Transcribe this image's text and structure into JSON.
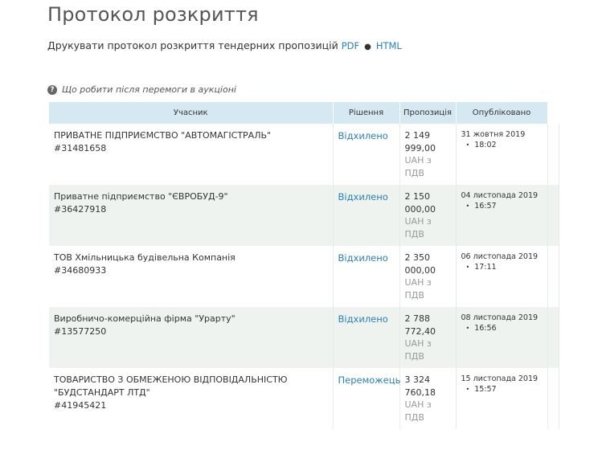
{
  "page": {
    "title": "Протокол розкриття",
    "print_text": "Друкувати протокол розкриття тендерних пропозицій",
    "pdf_link": "PDF",
    "separator": "●",
    "html_link": "HTML",
    "help_text": "Що робити після перемоги в аукціоні"
  },
  "table": {
    "headers": {
      "participant": "Учасник",
      "decision": "Рішення",
      "bid": "Пропозиція",
      "published": "Опубліковано"
    },
    "rows": [
      {
        "name": "ПРИВАТНЕ ПІДПРИЄМСТВО \"АВТОМАГІСТРАЛЬ\"",
        "code": "#31481658",
        "decision": "Відхилено",
        "amount_1": "2 149",
        "amount_2": "999,00",
        "currency_1": "UAH з",
        "currency_2": "ПДВ",
        "date": "31 жовтня 2019",
        "time": "18:02"
      },
      {
        "name": "Приватне підприємство \"ЄВРОБУД-9\"",
        "code": "#36427918",
        "decision": "Відхилено",
        "amount_1": "2 150",
        "amount_2": "000,00",
        "currency_1": "UAH з",
        "currency_2": "ПДВ",
        "date": "04 листопада 2019",
        "time": "16:57"
      },
      {
        "name": "ТОВ Хмільницька будівельна Компанія",
        "code": "#34680933",
        "decision": "Відхилено",
        "amount_1": "2 350",
        "amount_2": "000,00",
        "currency_1": "UAH з",
        "currency_2": "ПДВ",
        "date": "06 листопада 2019",
        "time": "17:11"
      },
      {
        "name": "Виробничо-комерційна фірма \"Урарту\"",
        "code": "#13577250",
        "decision": "Відхилено",
        "amount_1": "2 788",
        "amount_2": "772,40",
        "currency_1": "UAH з",
        "currency_2": "ПДВ",
        "date": "08 листопада 2019",
        "time": "16:56"
      },
      {
        "name": "ТОВАРИСТВО З ОБМЕЖЕНОЮ ВІДПОВІДАЛЬНІСТЮ \"БУДСТАНДАРТ ЛТД\"",
        "code": "#41945421",
        "decision": "Переможець",
        "amount_1": "3 324",
        "amount_2": "760,18",
        "currency_1": "UAH з",
        "currency_2": "ПДВ",
        "date": "15 листопада 2019",
        "time": "15:57"
      }
    ]
  },
  "colors": {
    "link": "#2a7fb8",
    "header_bg": "#d6e8f2",
    "alt_row_bg": "#eef3ef",
    "muted_text": "#999999"
  },
  "icons": {
    "help": "question-circle-icon"
  }
}
